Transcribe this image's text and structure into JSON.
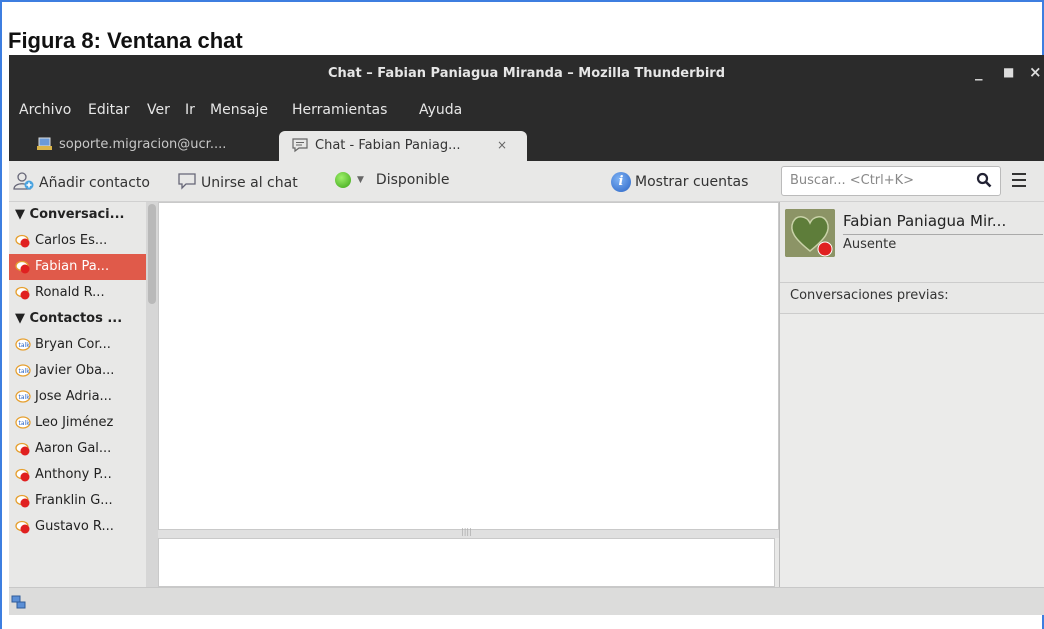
{
  "caption": "Figura 8: Ventana chat",
  "window": {
    "title": "Chat – Fabian Paniagua Miranda – Mozilla Thunderbird",
    "minimize": "_",
    "maximize": "▫",
    "close": "×"
  },
  "menu": [
    {
      "label": "Archivo"
    },
    {
      "label": "Editar"
    },
    {
      "label": "Ver"
    },
    {
      "label": "Ir"
    },
    {
      "label": "Mensaje"
    },
    {
      "label": "Herramientas"
    },
    {
      "label": "Ayuda"
    }
  ],
  "tabs": [
    {
      "label": "soporte.migracion@ucr....",
      "icon": "account-icon"
    },
    {
      "label": "Chat - Fabian Paniag...",
      "icon": "chat-icon",
      "close": "×"
    }
  ],
  "toolbar": {
    "add_contact": "Añadir contacto",
    "join_chat": "Unirse al chat",
    "status": "Disponible",
    "show_accounts": "Mostrar cuentas",
    "search_placeholder": "Buscar... <Ctrl+K>"
  },
  "sidebar": {
    "conversations_header": "▼ Conversaci...",
    "conversations": [
      {
        "label": "Carlos Es...",
        "status": "offline"
      },
      {
        "label": "Fabian Pa...",
        "status": "offline",
        "selected": true
      },
      {
        "label": "Ronald R...",
        "status": "offline"
      }
    ],
    "contacts_header": "▼ Contactos ...",
    "contacts": [
      {
        "label": "Bryan Cor...",
        "status": "online"
      },
      {
        "label": "Javier Oba...",
        "status": "online"
      },
      {
        "label": "Jose Adria...",
        "status": "online"
      },
      {
        "label": "Leo Jiménez",
        "status": "online"
      },
      {
        "label": "Aaron Gal...",
        "status": "offline"
      },
      {
        "label": "Anthony P...",
        "status": "offline"
      },
      {
        "label": "Franklin G...",
        "status": "offline"
      },
      {
        "label": "Gustavo R...",
        "status": "offline"
      }
    ]
  },
  "contact_panel": {
    "name": "Fabian Paniagua Mir...",
    "status": "Ausente",
    "previous_conversations": "Conversaciones previas:"
  },
  "colors": {
    "selected": "#e05a4a",
    "titlebar": "#2b2b2b",
    "frame": "#3d7ee0",
    "status_green": "#4fc22b"
  }
}
